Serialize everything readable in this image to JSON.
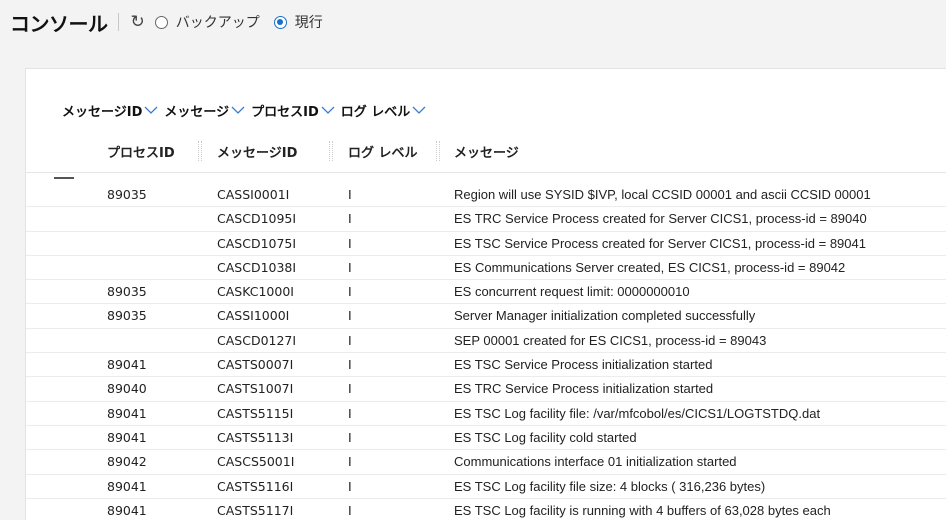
{
  "header": {
    "title": "コンソール",
    "radio_backup": "バックアップ",
    "radio_current": "現行"
  },
  "groupbar": {
    "items": [
      "メッセージID",
      "メッセージ",
      "プロセスID",
      "ログ レベル"
    ]
  },
  "columns": {
    "process_id": "プロセスID",
    "message_id": "メッセージID",
    "log_level": "ログ レベル",
    "message": "メッセージ"
  },
  "rows": [
    {
      "pid": "89035",
      "mid": "CASSI0001I",
      "lvl": "I",
      "msg": "Region will use SYSID $IVP, local CCSID 00001 and ascii CCSID 00001"
    },
    {
      "pid": "",
      "mid": "CASCD1095I",
      "lvl": "I",
      "msg": "ES TRC Service Process created for Server CICS1, process-id = 89040"
    },
    {
      "pid": "",
      "mid": "CASCD1075I",
      "lvl": "I",
      "msg": "ES TSC Service Process created for Server CICS1, process-id = 89041"
    },
    {
      "pid": "",
      "mid": "CASCD1038I",
      "lvl": "I",
      "msg": "ES Communications Server created, ES CICS1, process-id = 89042"
    },
    {
      "pid": "89035",
      "mid": "CASKC1000I",
      "lvl": "I",
      "msg": "ES concurrent request limit: 0000000010"
    },
    {
      "pid": "89035",
      "mid": "CASSI1000I",
      "lvl": "I",
      "msg": "Server Manager initialization completed successfully"
    },
    {
      "pid": "",
      "mid": "CASCD0127I",
      "lvl": "I",
      "msg": "SEP 00001 created for ES CICS1, process-id = 89043"
    },
    {
      "pid": "89041",
      "mid": "CASTS0007I",
      "lvl": "I",
      "msg": "ES TSC Service Process initialization started"
    },
    {
      "pid": "89040",
      "mid": "CASTS1007I",
      "lvl": "I",
      "msg": "ES TRC Service Process initialization started"
    },
    {
      "pid": "89041",
      "mid": "CASTS5115I",
      "lvl": "I",
      "msg": "ES TSC Log facility file: /var/mfcobol/es/CICS1/LOGTSTDQ.dat"
    },
    {
      "pid": "89041",
      "mid": "CASTS5113I",
      "lvl": "I",
      "msg": "ES TSC Log facility cold started"
    },
    {
      "pid": "89042",
      "mid": "CASCS5001I",
      "lvl": "I",
      "msg": "Communications interface 01 initialization started"
    },
    {
      "pid": "89041",
      "mid": "CASTS5116I",
      "lvl": "I",
      "msg": "ES TSC Log facility file size: 4 blocks ( 316,236 bytes)"
    },
    {
      "pid": "89041",
      "mid": "CASTS5117I",
      "lvl": "I",
      "msg": "ES TSC Log facility is running with 4 buffers of 63,028 bytes each"
    }
  ]
}
